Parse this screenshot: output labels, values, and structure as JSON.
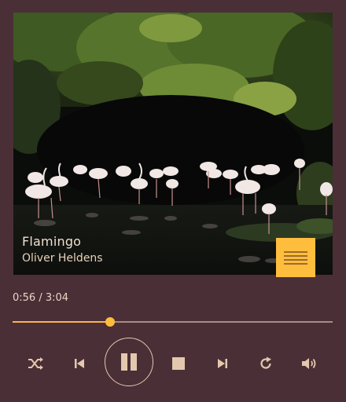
{
  "player": {
    "track_title": "Flamingo",
    "track_artist": "Oliver Heldens",
    "elapsed": "0:56",
    "duration": "3:04",
    "time_separator": " / ",
    "progress_fraction": 0.304
  },
  "icons": {
    "playlist": "playlist-icon",
    "shuffle": "shuffle-icon",
    "previous": "skip-previous-icon",
    "play_pause": "pause-icon",
    "stop": "stop-icon",
    "next": "skip-next-icon",
    "repeat": "repeat-icon",
    "volume": "volume-icon"
  },
  "colors": {
    "background": "#4a2f37",
    "accent": "#ffbd3e",
    "text": "#e9d6c3",
    "track": "#a98a83"
  }
}
